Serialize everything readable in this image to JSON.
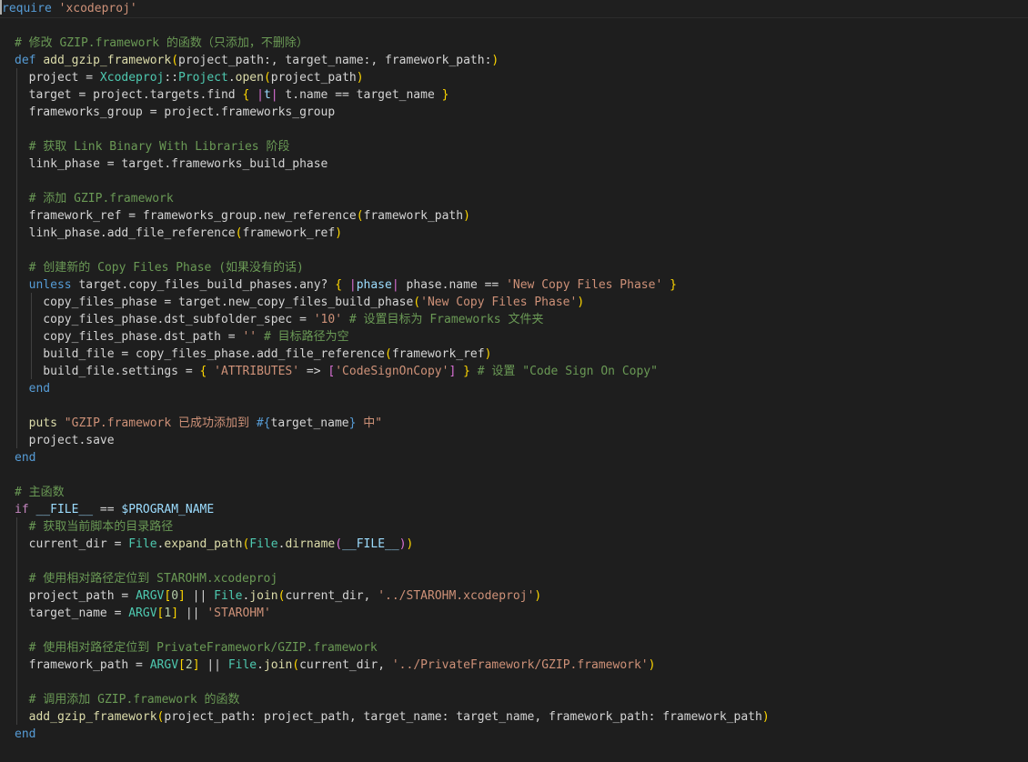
{
  "editor": {
    "language": "ruby",
    "colors": {
      "background": "#1e1e1e",
      "keyword": "#569cd6",
      "control": "#c586c0",
      "string": "#ce9178",
      "comment": "#6a9955",
      "function": "#dcdcaa",
      "variable": "#9cdcfe",
      "type": "#4ec9b0",
      "number": "#b5cea8",
      "bracket_1": "#ffd700",
      "bracket_2": "#da70d6",
      "bracket_3": "#179fff"
    },
    "lines": [
      [
        [
          "kw",
          "require"
        ],
        [
          "pun",
          " "
        ],
        [
          "str",
          "'xcodeproj'"
        ]
      ],
      [],
      [
        [
          "cmt",
          "# 修改 GZIP.framework 的函数（只添加，不删除）"
        ]
      ],
      [
        [
          "kw",
          "def"
        ],
        [
          "pun",
          " "
        ],
        [
          "fn",
          "add_gzip_framework"
        ],
        [
          "br1",
          "("
        ],
        [
          "pun",
          "project_path:, target_name:, framework_path:"
        ],
        [
          "br1",
          ")"
        ]
      ],
      [
        [
          "pun",
          "  project = "
        ],
        [
          "type",
          "Xcodeproj"
        ],
        [
          "pun",
          "::"
        ],
        [
          "type",
          "Project"
        ],
        [
          "pun",
          "."
        ],
        [
          "fn",
          "open"
        ],
        [
          "br1",
          "("
        ],
        [
          "pun",
          "project_path"
        ],
        [
          "br1",
          ")"
        ]
      ],
      [
        [
          "pun",
          "  target = project.targets.find "
        ],
        [
          "br1",
          "{"
        ],
        [
          "pun",
          " "
        ],
        [
          "br2",
          "|"
        ],
        [
          "var",
          "t"
        ],
        [
          "br2",
          "|"
        ],
        [
          "pun",
          " t.name == target_name "
        ],
        [
          "br1",
          "}"
        ]
      ],
      [
        [
          "pun",
          "  frameworks_group = project.frameworks_group"
        ]
      ],
      [],
      [
        [
          "pun",
          "  "
        ],
        [
          "cmt",
          "# 获取 Link Binary With Libraries 阶段"
        ]
      ],
      [
        [
          "pun",
          "  link_phase = target.frameworks_build_phase"
        ]
      ],
      [],
      [
        [
          "pun",
          "  "
        ],
        [
          "cmt",
          "# 添加 GZIP.framework"
        ]
      ],
      [
        [
          "pun",
          "  framework_ref = frameworks_group.new_reference"
        ],
        [
          "br1",
          "("
        ],
        [
          "pun",
          "framework_path"
        ],
        [
          "br1",
          ")"
        ]
      ],
      [
        [
          "pun",
          "  link_phase.add_file_reference"
        ],
        [
          "br1",
          "("
        ],
        [
          "pun",
          "framework_ref"
        ],
        [
          "br1",
          ")"
        ]
      ],
      [],
      [
        [
          "pun",
          "  "
        ],
        [
          "cmt",
          "# 创建新的 Copy Files Phase (如果没有的话)"
        ]
      ],
      [
        [
          "pun",
          "  "
        ],
        [
          "kw",
          "unless"
        ],
        [
          "pun",
          " target.copy_files_build_phases.any? "
        ],
        [
          "br1",
          "{"
        ],
        [
          "pun",
          " "
        ],
        [
          "br2",
          "|"
        ],
        [
          "var",
          "phase"
        ],
        [
          "br2",
          "|"
        ],
        [
          "pun",
          " phase.name == "
        ],
        [
          "str",
          "'New Copy Files Phase'"
        ],
        [
          "pun",
          " "
        ],
        [
          "br1",
          "}"
        ]
      ],
      [
        [
          "pun",
          "    copy_files_phase = target.new_copy_files_build_phase"
        ],
        [
          "br1",
          "("
        ],
        [
          "str",
          "'New Copy Files Phase'"
        ],
        [
          "br1",
          ")"
        ]
      ],
      [
        [
          "pun",
          "    copy_files_phase.dst_subfolder_spec = "
        ],
        [
          "str",
          "'10'"
        ],
        [
          "pun",
          " "
        ],
        [
          "cmt",
          "# 设置目标为 Frameworks 文件夹"
        ]
      ],
      [
        [
          "pun",
          "    copy_files_phase.dst_path = "
        ],
        [
          "str",
          "''"
        ],
        [
          "pun",
          " "
        ],
        [
          "cmt",
          "# 目标路径为空"
        ]
      ],
      [
        [
          "pun",
          "    build_file = copy_files_phase.add_file_reference"
        ],
        [
          "br1",
          "("
        ],
        [
          "pun",
          "framework_ref"
        ],
        [
          "br1",
          ")"
        ]
      ],
      [
        [
          "pun",
          "    build_file.settings = "
        ],
        [
          "br1",
          "{"
        ],
        [
          "pun",
          " "
        ],
        [
          "str",
          "'ATTRIBUTES'"
        ],
        [
          "pun",
          " => "
        ],
        [
          "br2",
          "["
        ],
        [
          "str",
          "'CodeSignOnCopy'"
        ],
        [
          "br2",
          "]"
        ],
        [
          "pun",
          " "
        ],
        [
          "br1",
          "}"
        ],
        [
          "pun",
          " "
        ],
        [
          "cmt",
          "# 设置 \"Code Sign On Copy\""
        ]
      ],
      [
        [
          "pun",
          "  "
        ],
        [
          "kw",
          "end"
        ]
      ],
      [],
      [
        [
          "pun",
          "  "
        ],
        [
          "fn",
          "puts"
        ],
        [
          "pun",
          " "
        ],
        [
          "str",
          "\"GZIP.framework 已成功添加到 "
        ],
        [
          "kw",
          "#{"
        ],
        [
          "pun",
          "target_name"
        ],
        [
          "kw",
          "}"
        ],
        [
          "str",
          " 中\""
        ]
      ],
      [
        [
          "pun",
          "  project.save"
        ]
      ],
      [
        [
          "kw",
          "end"
        ]
      ],
      [],
      [
        [
          "cmt",
          "# 主函数"
        ]
      ],
      [
        [
          "ctrl",
          "if"
        ],
        [
          "pun",
          " "
        ],
        [
          "var",
          "__FILE__"
        ],
        [
          "pun",
          " == "
        ],
        [
          "var",
          "$PROGRAM_NAME"
        ]
      ],
      [
        [
          "pun",
          "  "
        ],
        [
          "cmt",
          "# 获取当前脚本的目录路径"
        ]
      ],
      [
        [
          "pun",
          "  current_dir = "
        ],
        [
          "type",
          "File"
        ],
        [
          "pun",
          "."
        ],
        [
          "fn",
          "expand_path"
        ],
        [
          "br1",
          "("
        ],
        [
          "type",
          "File"
        ],
        [
          "pun",
          "."
        ],
        [
          "fn",
          "dirname"
        ],
        [
          "br2",
          "("
        ],
        [
          "var",
          "__FILE__"
        ],
        [
          "br2",
          ")"
        ],
        [
          "br1",
          ")"
        ]
      ],
      [],
      [
        [
          "pun",
          "  "
        ],
        [
          "cmt",
          "# 使用相对路径定位到 STAROHM.xcodeproj"
        ]
      ],
      [
        [
          "pun",
          "  project_path = "
        ],
        [
          "type",
          "ARGV"
        ],
        [
          "br1",
          "["
        ],
        [
          "num",
          "0"
        ],
        [
          "br1",
          "]"
        ],
        [
          "pun",
          " || "
        ],
        [
          "type",
          "File"
        ],
        [
          "pun",
          "."
        ],
        [
          "fn",
          "join"
        ],
        [
          "br1",
          "("
        ],
        [
          "pun",
          "current_dir, "
        ],
        [
          "str",
          "'../STAROHM.xcodeproj'"
        ],
        [
          "br1",
          ")"
        ]
      ],
      [
        [
          "pun",
          "  target_name = "
        ],
        [
          "type",
          "ARGV"
        ],
        [
          "br1",
          "["
        ],
        [
          "num",
          "1"
        ],
        [
          "br1",
          "]"
        ],
        [
          "pun",
          " || "
        ],
        [
          "str",
          "'STAROHM'"
        ]
      ],
      [],
      [
        [
          "pun",
          "  "
        ],
        [
          "cmt",
          "# 使用相对路径定位到 PrivateFramework/GZIP.framework"
        ]
      ],
      [
        [
          "pun",
          "  framework_path = "
        ],
        [
          "type",
          "ARGV"
        ],
        [
          "br1",
          "["
        ],
        [
          "num",
          "2"
        ],
        [
          "br1",
          "]"
        ],
        [
          "pun",
          " || "
        ],
        [
          "type",
          "File"
        ],
        [
          "pun",
          "."
        ],
        [
          "fn",
          "join"
        ],
        [
          "br1",
          "("
        ],
        [
          "pun",
          "current_dir, "
        ],
        [
          "str",
          "'../PrivateFramework/GZIP.framework'"
        ],
        [
          "br1",
          ")"
        ]
      ],
      [],
      [
        [
          "pun",
          "  "
        ],
        [
          "cmt",
          "# 调用添加 GZIP.framework 的函数"
        ]
      ],
      [
        [
          "pun",
          "  "
        ],
        [
          "fn",
          "add_gzip_framework"
        ],
        [
          "br1",
          "("
        ],
        [
          "pun",
          "project_path: project_path, target_name: target_name, framework_path: framework_path"
        ],
        [
          "br1",
          ")"
        ]
      ],
      [
        [
          "kw",
          "end"
        ]
      ]
    ]
  }
}
